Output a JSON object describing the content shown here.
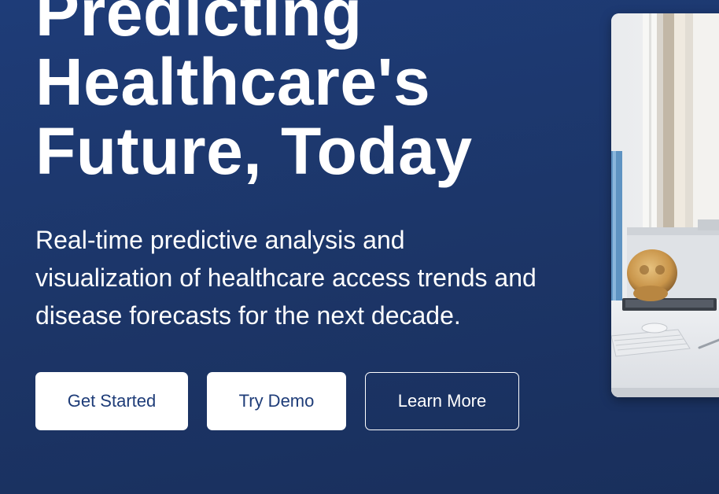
{
  "hero": {
    "title_lines": [
      "Predicting",
      "Healthcare's",
      "Future, Today"
    ],
    "subtitle_lines": [
      "Real-time predictive analysis and",
      "visualization of healthcare access trends and",
      "disease forecasts for the next decade."
    ],
    "buttons": {
      "get_started": "Get Started",
      "try_demo": "Try Demo",
      "learn_more": "Learn More"
    },
    "image_icon": "medical-office-photo"
  },
  "colors": {
    "background": "#1e3c78",
    "button_text": "#1e3c78",
    "text": "#ffffff"
  }
}
